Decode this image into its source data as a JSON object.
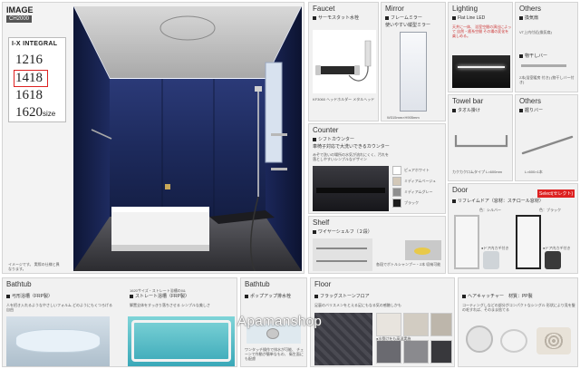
{
  "image": {
    "title": "IMAGE",
    "model": "CH2000",
    "series_title": "I-X INTEGRAL",
    "sizes": [
      "1216",
      "1418",
      "1618",
      "1620"
    ],
    "size_suffix": "size",
    "selected_size": "1418",
    "caption": "イメージです。 実際の仕様と異なります。"
  },
  "faucet": {
    "title": "Faucet",
    "item": "サーモスタット水栓",
    "note": "KF3060 ヘッドホルダー メタルヘッド"
  },
  "mirror": {
    "title": "Mirror",
    "item": "フレームミラー",
    "desc": "使いやすい縦型ミラー",
    "size": "W315mm×H905mm"
  },
  "lighting": {
    "title": "Lighting",
    "item": "Flat Line LED",
    "desc": "天井に一体、 浴室空間の演出によって 自然・癒系空間 その場の変化を楽しめる。"
  },
  "others1": {
    "title": "Others",
    "item": "換気扇",
    "note": "VT上内付近(換気扇)",
    "item2": "物干しバー",
    "note2": "2本(浴室暖房 付き) (物干しバー付き)"
  },
  "towel": {
    "title": "Towel bar",
    "item": "タオル掛け",
    "note": "カクカクロムタイプ L=600mm"
  },
  "others2": {
    "title": "Others",
    "item": "握りバー",
    "note": "L=600×1本"
  },
  "counter": {
    "title": "Counter",
    "item": "シフトカウンター",
    "desc": "車椅子対応で大洗いできるカウンター",
    "body": "みぞで洗いの場所の水気が流れにくく、汚れを落としやすいシンプルなデザイン",
    "colors": [
      {
        "name": "ピュアホワイト",
        "hex": "#ffffff"
      },
      {
        "name": "ミディアムベージュ",
        "hex": "#d3c8b8"
      },
      {
        "name": "ミディアムグレー",
        "hex": "#8e8e8e"
      },
      {
        "name": "ブラック",
        "hex": "#1c1c1c"
      }
    ]
  },
  "shelf": {
    "title": "Shelf",
    "item": "ワイヤーシェルフ（２段）",
    "note": "各段でボトルシャンプー・2本 収納可能"
  },
  "door": {
    "title": "Door",
    "badge": "Select(セレクト)",
    "item": "リフレイムドア（窓材：スチロール窓材）",
    "opt1": "色：シルバー",
    "opt2": "色：ブラック",
    "cap1": "●ドア内カギ付き",
    "cap2": "●ドア内カギ付き"
  },
  "bathtub": {
    "title": "Bathtub",
    "item1": "弓形浴槽〈FRP製〉",
    "desc1": "人を招き入れるようなやさしいフォルム どのようにもくつろげる自由",
    "badge2": "1620サイズ・ストレート浴槽の0&",
    "item2": "ストレート浴槽〈FRP製〉",
    "desc2": "脚置全体をすっきり落ちさせる シンプルな美しさ"
  },
  "bathtub2": {
    "title": "Bathtub",
    "item": "ポップアップ排水栓",
    "desc": "ワンタッチ操作で排水が可能、 チェーンで作動が簡単なもの、 衛生面にも配慮"
  },
  "floor": {
    "title": "Floor",
    "item": "フラッグストーンフロア",
    "desc": "足裏のバリスメンをとえる足にもなる気の感触しかも",
    "cap": "●水捌けをも高温実施"
  },
  "catcher": {
    "item": "ヘアキャッチャー　材質：PP製",
    "desc": "コーティングしなどの部分がコンパクトなシングル 形状により見を髪の毛すれば、そのまま捨てる"
  },
  "watermark": "Apamanshop",
  "colors": {
    "navy": "#1a2552",
    "accent_red": "#d22222",
    "accent_blue": "#2a5aa8"
  }
}
